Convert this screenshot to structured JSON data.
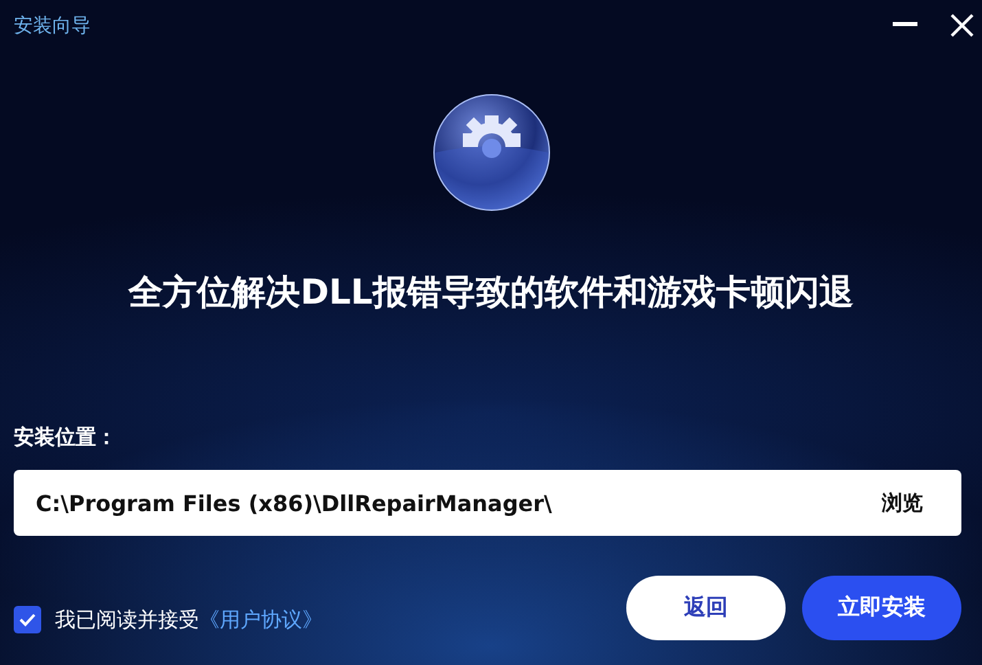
{
  "window": {
    "title": "安装向导"
  },
  "headline": "全方位解决DLL报错导致的软件和游戏卡顿闪退",
  "install_location": {
    "label": "安装位置：",
    "value": "C:\\Program Files (x86)\\DllRepairManager\\",
    "browse_button": "浏览"
  },
  "agreement": {
    "checked": true,
    "text": "我已阅读并接受",
    "link": "《用户协议》"
  },
  "buttons": [
    {
      "label": "返回",
      "kind": "secondary"
    },
    {
      "label": "立即安装",
      "kind": "primary"
    }
  ]
}
